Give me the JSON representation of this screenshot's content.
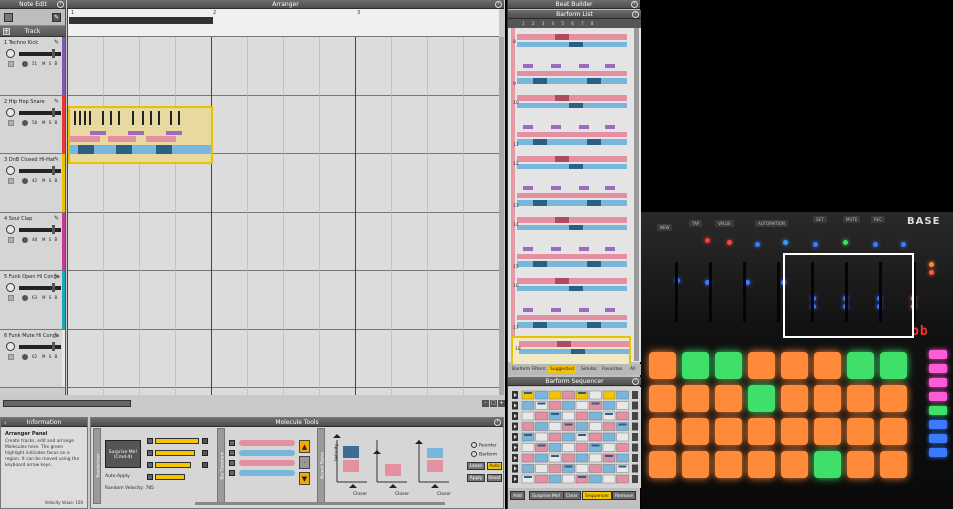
{
  "note_edit": {
    "title": "Note Edit"
  },
  "arranger": {
    "title": "Arranger",
    "ruler_numbers": [
      "1",
      "2",
      "3"
    ],
    "track_header": "Track",
    "tracks": [
      {
        "name": "1 Techno Kick",
        "vel": "51",
        "color": "#7f5aa8"
      },
      {
        "name": "2 Hip Hop Snare",
        "vel": "58",
        "color": "#e23a3a"
      },
      {
        "name": "3 DnB Closed Hi-Hat",
        "vel": "42",
        "color": "#e6c200"
      },
      {
        "name": "4 Soul Clap",
        "vel": "48",
        "color": "#c23a9a"
      },
      {
        "name": "5 Funk Open Hi Conga",
        "vel": "63",
        "color": "#1ea8b8"
      },
      {
        "name": "6 Funk Mute Hi Conga",
        "vel": "62",
        "color": "#e6e6e6"
      }
    ],
    "msb": "M S B"
  },
  "info": {
    "header": "Information",
    "title": "Arranger Panel",
    "body": "Create tracks, edit and arrange Molecules here. The green highlight indicates focus on a region. It can be moved using the keyboard arrow keys.",
    "velocity": "Velocity Value: 100"
  },
  "molecule_tools": {
    "header": "Molecule Tools",
    "tabs": [
      "Randomizer",
      "Bar Transform",
      "Accent Styles"
    ],
    "surprise_button": "Surprise Me! (Cmd-4)",
    "auto_apply": "Auto-Apply",
    "random_velocity": "Random Velocity: 785",
    "radio_reorder": "Reorder",
    "radio_barform": "Barform",
    "btn_learn": "Learn",
    "btn_auto": "Auto",
    "btn_apply": "Apply",
    "btn_reset": "Reset",
    "axis_velocity": "Velocity",
    "axis_closer": "Closer"
  },
  "beat_builder": {
    "title": "Beat Builder",
    "barform_list": "Barform List",
    "columns": [
      "1",
      "2",
      "3",
      "4",
      "5",
      "6",
      "7",
      "8"
    ],
    "rows": [
      "8",
      "9",
      "10",
      "11",
      "12",
      "13",
      "14",
      "15",
      "16",
      "17",
      "18"
    ],
    "filters_label": "Barform Filters:",
    "filters": [
      "Suggested",
      "Similar",
      "Favorites",
      "All"
    ],
    "filter_selected": "Suggested",
    "sequencer_title": "Barform Sequencer",
    "bottom_buttons": [
      "Add",
      "Surprise Me!",
      "Clear",
      "Sequencer",
      "Remove"
    ],
    "bottom_selected": "Sequencer"
  },
  "hardware": {
    "brand": "BASE",
    "display": "bb",
    "buttons": [
      "NEW",
      "TAP",
      "VALUE",
      "AUTOMATION",
      "SET",
      "MUTE",
      "REC"
    ],
    "colors": {
      "orange": "#ff8a3a",
      "green": "#3fe06a",
      "pink": "#ff5ad8",
      "blue": "#3a7bff"
    }
  }
}
